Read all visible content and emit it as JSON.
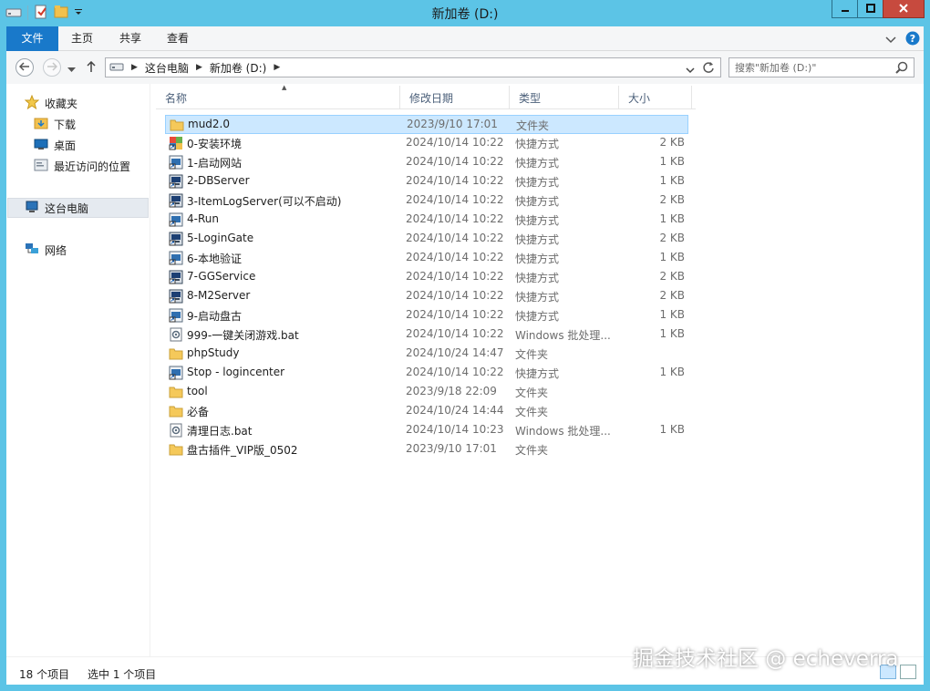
{
  "window": {
    "title": "新加卷 (D:)",
    "minimize_icon": "minimize-icon",
    "maximize_icon": "maximize-icon",
    "close_icon": "close-icon",
    "close_color": "#c74a3e",
    "frame_color": "#5cc4e6"
  },
  "ribbon": {
    "tabs": [
      {
        "label": "文件",
        "active": true
      },
      {
        "label": "主页"
      },
      {
        "label": "共享"
      },
      {
        "label": "查看"
      }
    ],
    "accent": "#1979ca"
  },
  "address": {
    "crumbs": [
      "这台电脑",
      "新加卷 (D:)"
    ]
  },
  "search": {
    "placeholder": "搜索\"新加卷 (D:)\""
  },
  "nav": {
    "favorites_label": "收藏夹",
    "favorites": [
      "下载",
      "桌面",
      "最近访问的位置"
    ],
    "this_pc": "这台电脑",
    "network": "网络"
  },
  "columns": {
    "name": "名称",
    "date": "修改日期",
    "type": "类型",
    "size": "大小"
  },
  "files": [
    {
      "name": "mud2.0",
      "date": "2023/9/10 17:01",
      "type": "文件夹",
      "size": "",
      "icon": "folder-icon",
      "selected": true
    },
    {
      "name": "0-安装环境",
      "date": "2024/10/14 10:22",
      "type": "快捷方式",
      "size": "2 KB",
      "icon": "installer-shortcut-icon"
    },
    {
      "name": "1-启动网站",
      "date": "2024/10/14 10:22",
      "type": "快捷方式",
      "size": "1 KB",
      "icon": "shortcut-icon"
    },
    {
      "name": "2-DBServer",
      "date": "2024/10/14 10:22",
      "type": "快捷方式",
      "size": "1 KB",
      "icon": "app-shortcut-icon"
    },
    {
      "name": "3-ItemLogServer(可以不启动)",
      "date": "2024/10/14 10:22",
      "type": "快捷方式",
      "size": "2 KB",
      "icon": "app-shortcut-icon"
    },
    {
      "name": "4-Run",
      "date": "2024/10/14 10:22",
      "type": "快捷方式",
      "size": "1 KB",
      "icon": "shortcut-icon"
    },
    {
      "name": "5-LoginGate",
      "date": "2024/10/14 10:22",
      "type": "快捷方式",
      "size": "2 KB",
      "icon": "app-shortcut-icon"
    },
    {
      "name": "6-本地验证",
      "date": "2024/10/14 10:22",
      "type": "快捷方式",
      "size": "1 KB",
      "icon": "shortcut-icon"
    },
    {
      "name": "7-GGService",
      "date": "2024/10/14 10:22",
      "type": "快捷方式",
      "size": "2 KB",
      "icon": "app-shortcut-icon"
    },
    {
      "name": "8-M2Server",
      "date": "2024/10/14 10:22",
      "type": "快捷方式",
      "size": "2 KB",
      "icon": "app-shortcut-icon"
    },
    {
      "name": "9-启动盘古",
      "date": "2024/10/14 10:22",
      "type": "快捷方式",
      "size": "1 KB",
      "icon": "shortcut-icon"
    },
    {
      "name": "999-一键关闭游戏.bat",
      "date": "2024/10/14 10:22",
      "type": "Windows 批处理...",
      "size": "1 KB",
      "icon": "batch-file-icon"
    },
    {
      "name": "phpStudy",
      "date": "2024/10/24 14:47",
      "type": "文件夹",
      "size": "",
      "icon": "folder-icon"
    },
    {
      "name": "Stop - logincenter",
      "date": "2024/10/14 10:22",
      "type": "快捷方式",
      "size": "1 KB",
      "icon": "shortcut-icon"
    },
    {
      "name": "tool",
      "date": "2023/9/18 22:09",
      "type": "文件夹",
      "size": "",
      "icon": "folder-icon"
    },
    {
      "name": "必备",
      "date": "2024/10/24 14:44",
      "type": "文件夹",
      "size": "",
      "icon": "folder-icon"
    },
    {
      "name": "清理日志.bat",
      "date": "2024/10/14 10:23",
      "type": "Windows 批处理...",
      "size": "1 KB",
      "icon": "batch-file-icon"
    },
    {
      "name": "盘古插件_VIP版_0502",
      "date": "2023/9/10 17:01",
      "type": "文件夹",
      "size": "",
      "icon": "folder-icon"
    }
  ],
  "status": {
    "count": "18 个项目",
    "selected": "选中 1 个项目"
  },
  "watermark": "掘金技术社区 @ echeverra"
}
